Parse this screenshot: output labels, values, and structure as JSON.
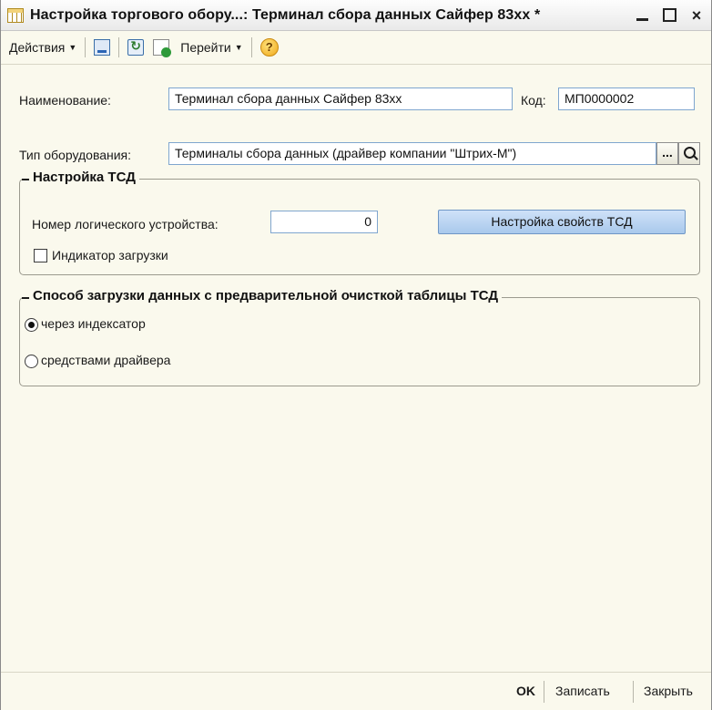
{
  "window": {
    "title": "Настройка торгового обору...: Терминал сбора данных Сайфер 83хх *",
    "controls": {
      "minimize": "_",
      "maximize": "□",
      "close": "×"
    }
  },
  "toolbar": {
    "actions_label": "Действия",
    "goto_label": "Перейти",
    "help_symbol": "?",
    "icons": [
      "save-and-close-icon",
      "refresh-icon",
      "new-from-copy-icon",
      "help-icon"
    ]
  },
  "form": {
    "name_label": "Наименование:",
    "name_value": "Терминал сбора данных Сайфер 83хх",
    "code_label": "Код:",
    "code_value": "МП0000002",
    "equipment_type_label": "Тип оборудования:",
    "equipment_type_value": "Терминалы сбора данных (драйвер компании \"Штрих-М\")",
    "select_button": "...",
    "group_tsd": {
      "title": "Настройка ТСД",
      "logical_device_label": "Номер логического устройства:",
      "logical_device_value": "0",
      "settings_button": "Настройка свойств ТСД",
      "load_indicator_label": "Индикатор загрузки",
      "load_indicator_checked": false
    },
    "group_load": {
      "title": "Способ загрузки данных с предварительной очисткой таблицы ТСД",
      "options": [
        {
          "label": "через индексатор",
          "selected": true
        },
        {
          "label": "средствами драйвера",
          "selected": false
        }
      ]
    }
  },
  "footer": {
    "ok_label": "OK",
    "save_label": "Записать",
    "close_label": "Закрыть"
  }
}
